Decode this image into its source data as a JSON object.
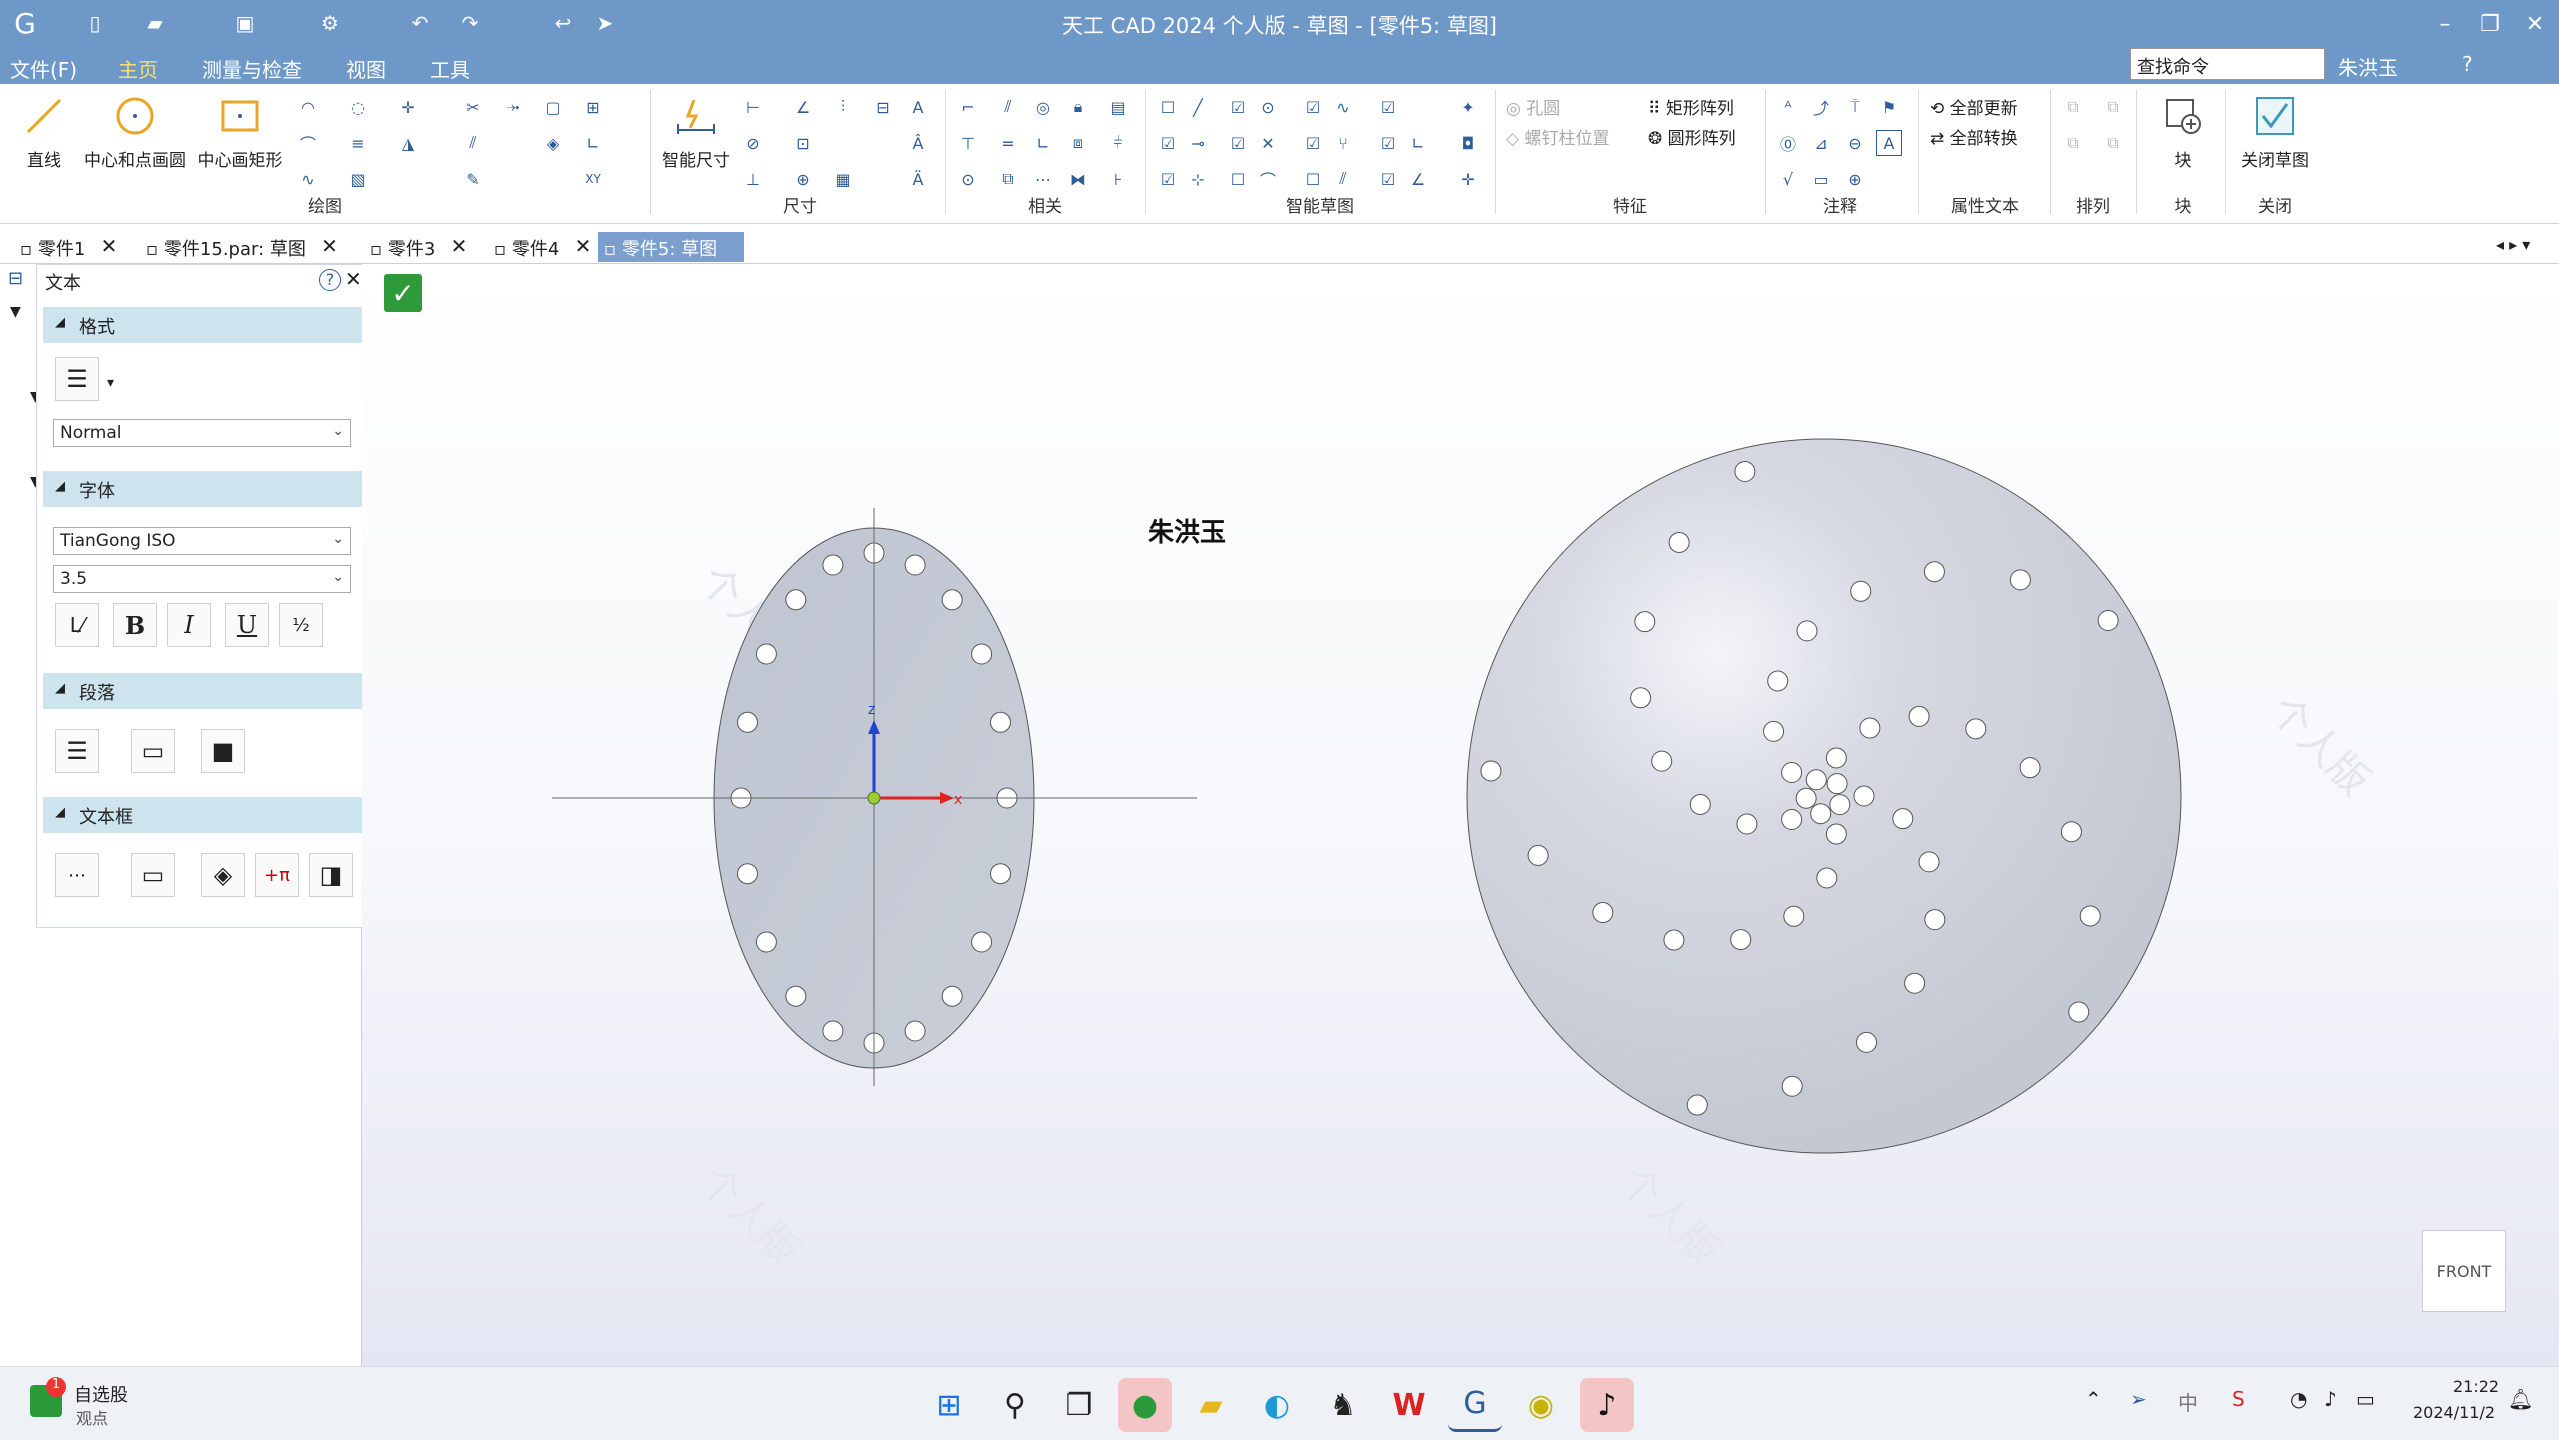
{
  "window": {
    "title": "天工 CAD 2024 个人版 - 草图 - [零件5: 草图]"
  },
  "menu": {
    "items": [
      "文件(F)",
      "主页",
      "测量与检查",
      "视图",
      "工具"
    ],
    "active_index": 1
  },
  "search": {
    "placeholder": "查找命令"
  },
  "user": {
    "name": "朱洪玉"
  },
  "ribbon": {
    "line": "直线",
    "circle_center": "中心和点画圆",
    "rect_center": "中心画矩形",
    "smart_dim": "智能尺寸",
    "hole": "孔圆",
    "bolt_pos": "螺钉柱位置",
    "rect_array": "矩形阵列",
    "circle_array": "圆形阵列",
    "update_all": "全部更新",
    "convert_all": "全部转换",
    "block": "块",
    "close_sketch": "关闭草图",
    "groups": {
      "draw": "绘图",
      "dim": "尺寸",
      "related": "相关",
      "smart_sketch": "智能草图",
      "feature": "特征",
      "annotate": "注释",
      "prop_text": "属性文本",
      "arrange": "排列",
      "block": "块",
      "close": "关闭"
    }
  },
  "tabs": [
    "零件1",
    "零件15.par: 草图",
    "零件3",
    "零件4",
    "零件5: 草图"
  ],
  "panel": {
    "title": "文本",
    "format": "格式",
    "style": "Normal",
    "font_section": "字体",
    "font": "TianGong ISO",
    "size": "3.5",
    "paragraph": "段落",
    "textbox": "文本框"
  },
  "canvas": {
    "annotation_text": "朱洪玉",
    "axis_x": "x",
    "axis_z": "z",
    "view_cube": "FRONT",
    "watermark": "个人版"
  },
  "taskbar": {
    "stock_title": "自选股",
    "stock_sub": "观点",
    "badge": "1",
    "time": "21:22",
    "date": "2024/11/2"
  },
  "colors": {
    "titlebar": "#6e98c8",
    "accent": "#f5e16b",
    "part_fill": "#c9ced8"
  }
}
